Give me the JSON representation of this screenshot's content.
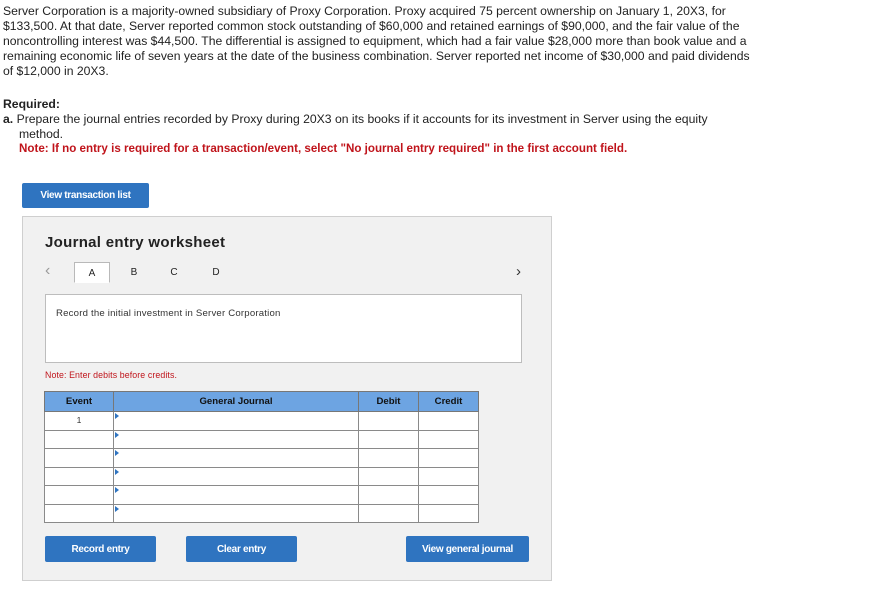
{
  "problem": {
    "text": "Server Corporation is a majority-owned subsidiary of Proxy Corporation. Proxy acquired 75 percent ownership on January 1, 20X3, for $133,500. At that date, Server reported common stock outstanding of $60,000 and retained earnings of $90,000, and the fair value of the noncontrolling interest was $44,500. The differential is assigned to equipment, which had a fair value $28,000 more than book value and a remaining economic life of seven years at the date of the business combination. Server reported net income of $30,000 and paid dividends of $12,000 in 20X3."
  },
  "required": {
    "label": "Required:",
    "part_letter": "a.",
    "part_text_line1": "Prepare the journal entries recorded by Proxy during 20X3 on its books if it accounts for its investment in Server using the equity",
    "part_text_line2": "method.",
    "note": "Note: If no entry is required for a transaction/event, select \"No journal entry required\" in the first account field."
  },
  "buttons": {
    "view_transaction_list": "View transaction list",
    "record_entry": "Record entry",
    "clear_entry": "Clear entry",
    "view_general_journal": "View general journal"
  },
  "worksheet": {
    "title": "Journal entry worksheet",
    "tabs": [
      "A",
      "B",
      "C",
      "D"
    ],
    "active_tab": "A",
    "description": "Record the initial investment in Server Corporation",
    "note": "Note: Enter debits before credits.",
    "columns": {
      "event": "Event",
      "general_journal": "General Journal",
      "debit": "Debit",
      "credit": "Credit"
    },
    "rows": [
      {
        "event": "1",
        "account": "",
        "debit": "",
        "credit": ""
      },
      {
        "event": "",
        "account": "",
        "debit": "",
        "credit": ""
      },
      {
        "event": "",
        "account": "",
        "debit": "",
        "credit": ""
      },
      {
        "event": "",
        "account": "",
        "debit": "",
        "credit": ""
      },
      {
        "event": "",
        "account": "",
        "debit": "",
        "credit": ""
      },
      {
        "event": "",
        "account": "",
        "debit": "",
        "credit": ""
      }
    ]
  },
  "icons": {
    "prev": "chevron-left-icon",
    "next": "chevron-right-icon"
  }
}
